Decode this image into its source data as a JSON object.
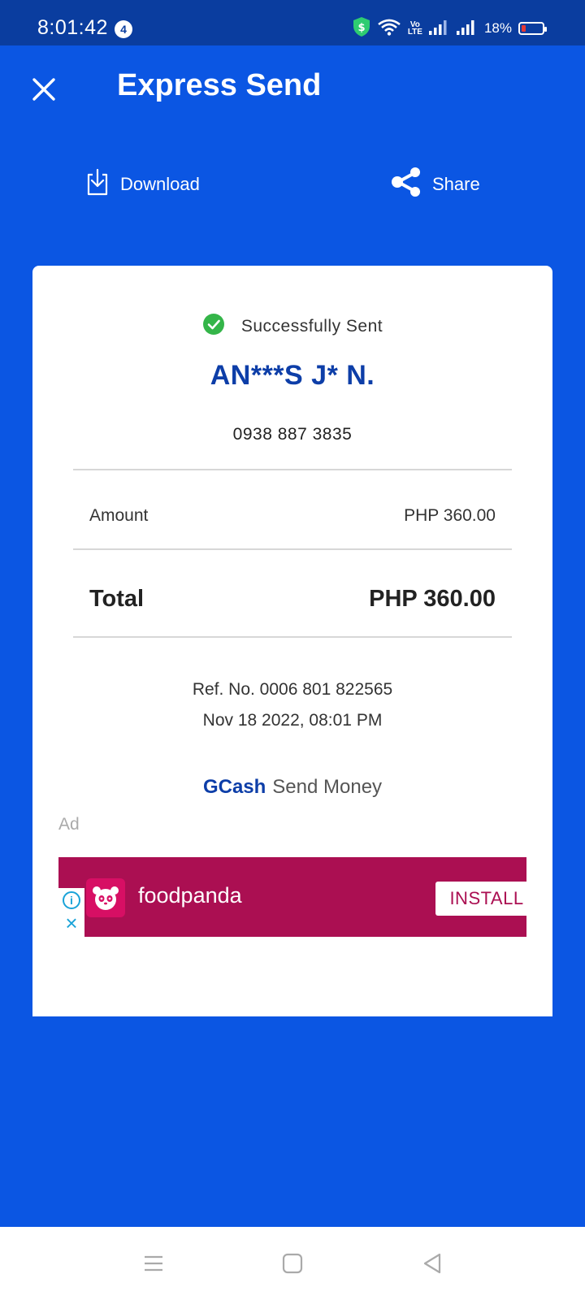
{
  "status_bar": {
    "time": "8:01:42",
    "notification_count": "4",
    "volte_label": "Vo\nLTE",
    "battery_percent": "18%",
    "battery_level": 0.18,
    "icons": [
      "shield-dollar-icon",
      "wifi-icon",
      "volte-icon",
      "signal-icon",
      "signal-icon",
      "battery-icon"
    ]
  },
  "header": {
    "title": "Express Send",
    "close_icon": "close-icon"
  },
  "actions": {
    "download_label": "Download",
    "share_label": "Share"
  },
  "receipt": {
    "status": "Successfully Sent",
    "recipient_name": "AN***S J* N.",
    "recipient_number": "0938 887 3835",
    "amount_label": "Amount",
    "amount_value": "PHP 360.00",
    "total_label": "Total",
    "total_value": "PHP 360.00",
    "reference": "Ref. No. 0006 801 822565",
    "datetime": "Nov 18 2022, 08:01 PM",
    "brand_name": "GCash",
    "brand_service": "Send Money"
  },
  "ad": {
    "label": "Ad",
    "advertiser": "foodpanda",
    "cta": "INSTALL",
    "background_color": "#ab0f52"
  },
  "colors": {
    "primary_blue": "#0b56e3",
    "status_bar": "#0a3d9f",
    "brand_text_blue": "#0d3ea8",
    "success_green": "#34b549"
  },
  "nav_bar": {
    "buttons": [
      "menu-icon",
      "home-icon",
      "back-icon"
    ]
  }
}
